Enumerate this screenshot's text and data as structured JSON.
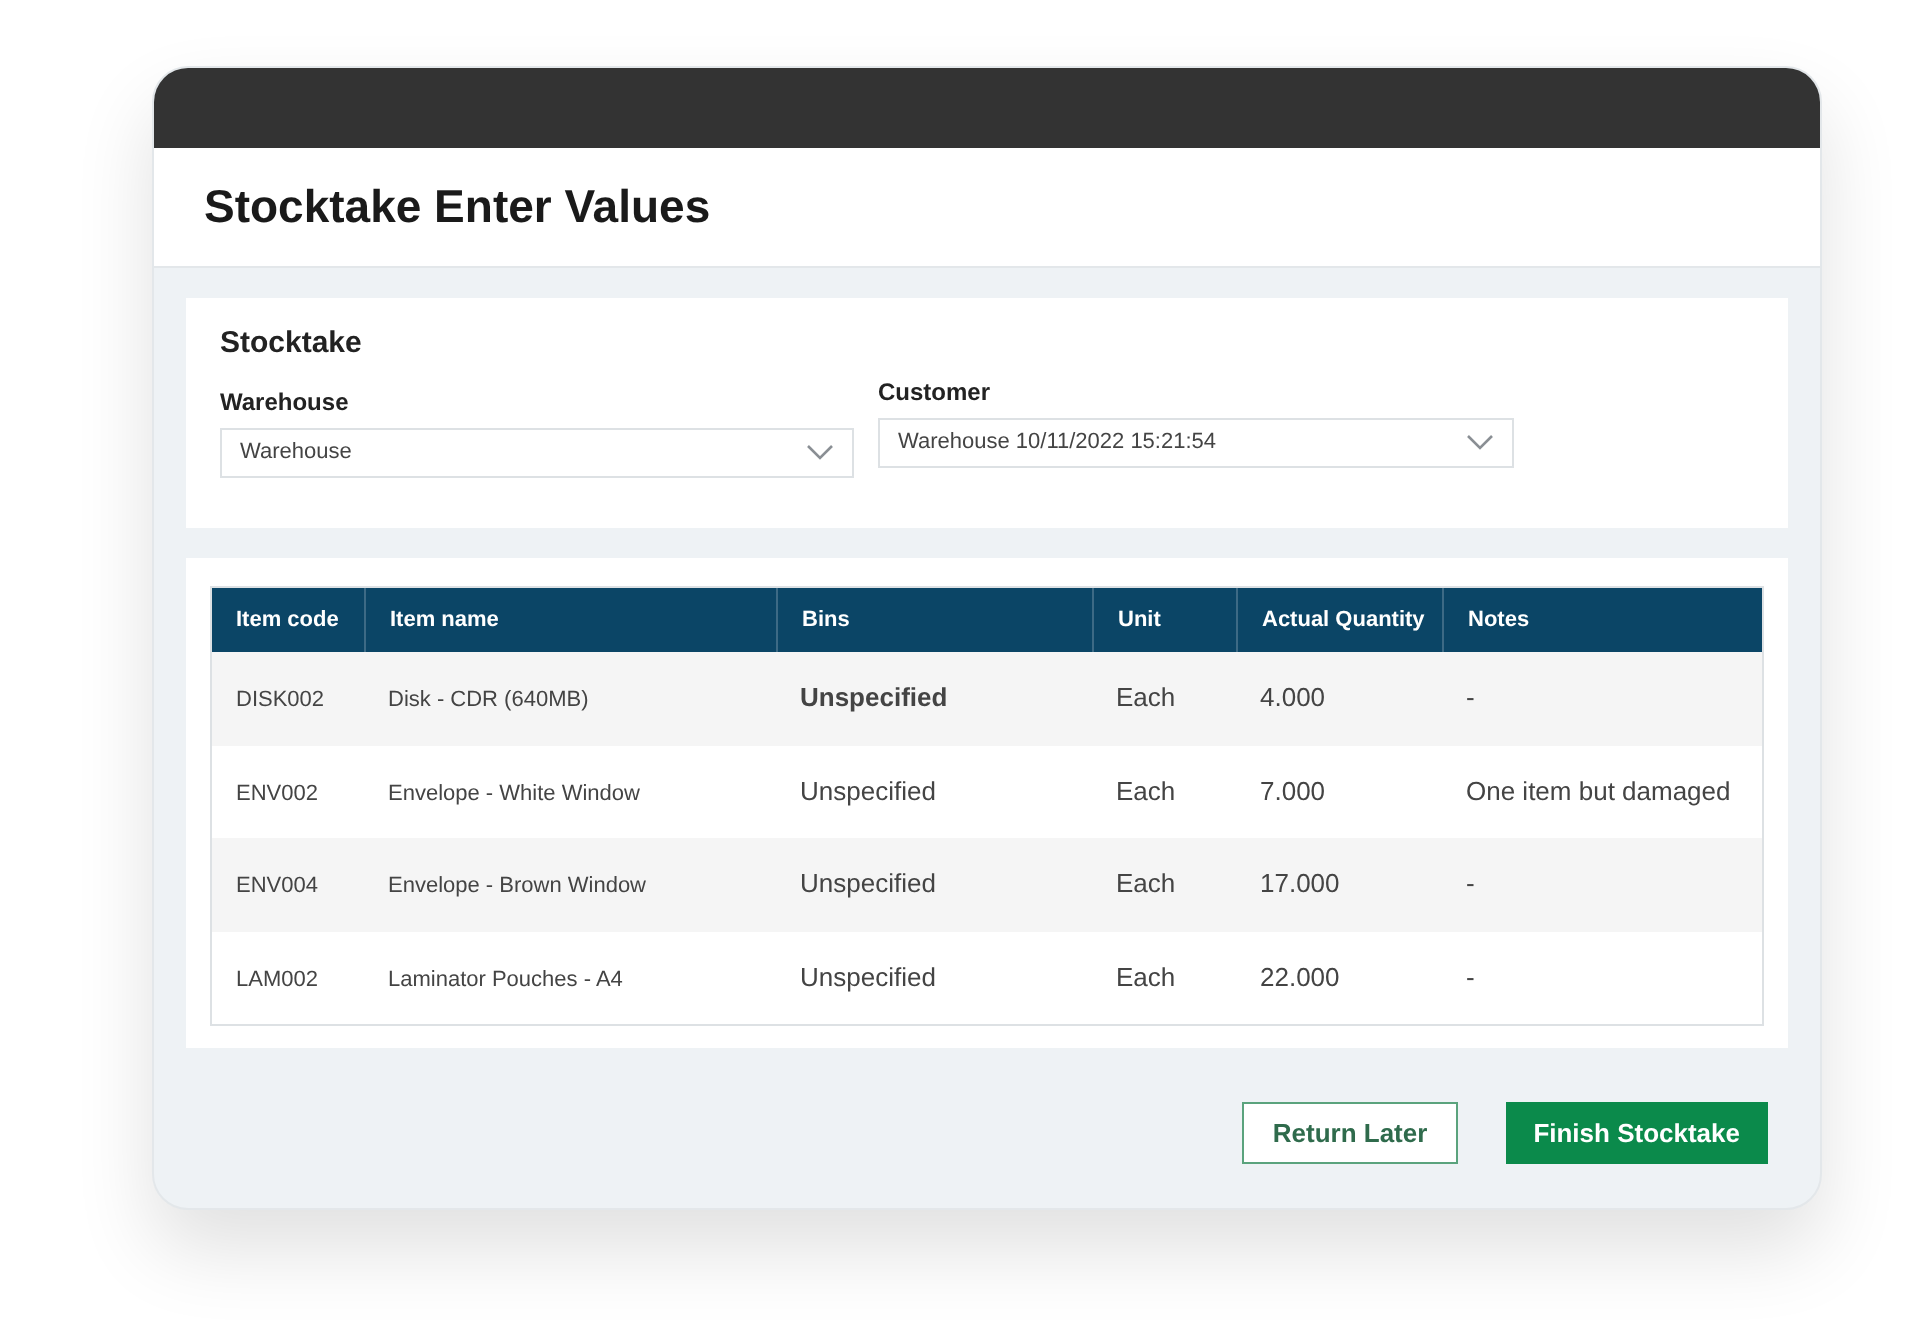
{
  "page_title": "Stocktake Enter Values",
  "form": {
    "title": "Stocktake",
    "fields": [
      {
        "label": "Warehouse",
        "value": "Warehouse"
      },
      {
        "label": "Customer",
        "value": "Warehouse 10/11/2022 15:21:54"
      }
    ]
  },
  "table": {
    "columns": [
      "Item code",
      "Item name",
      "Bins",
      "Unit",
      "Actual Quantity",
      "Notes"
    ],
    "rows": [
      {
        "cells": [
          "DISK002",
          "Disk - CDR (640MB)",
          "Unspecified",
          "Each",
          "4.000",
          "-"
        ],
        "bins_bold": true
      },
      {
        "cells": [
          "ENV002",
          "Envelope - White Window",
          "Unspecified",
          "Each",
          "7.000",
          "One item but damaged"
        ],
        "bins_bold": false
      },
      {
        "cells": [
          "ENV004",
          "Envelope - Brown Window",
          "Unspecified",
          "Each",
          "17.000",
          "-"
        ],
        "bins_bold": false
      },
      {
        "cells": [
          "LAM002",
          "Laminator Pouches - A4",
          "Unspecified",
          "Each",
          "22.000",
          "-"
        ],
        "bins_bold": false
      }
    ]
  },
  "buttons": [
    {
      "label": "Return Later",
      "kind": "secondary"
    },
    {
      "label": "Finish Stocktake",
      "kind": "primary"
    }
  ]
}
